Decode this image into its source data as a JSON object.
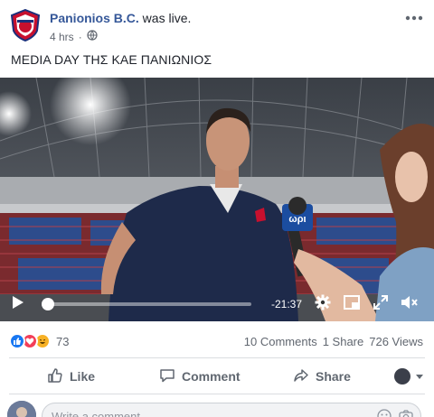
{
  "header": {
    "page_name": "Panionios B.C.",
    "action_text": " was live.",
    "time_ago": "4 hrs",
    "privacy_icon": "globe-icon",
    "more_icon": "more-dots-icon"
  },
  "post": {
    "caption": "MEDIA DAY ΤΗΣ ΚΑΕ ΠΑΝΙΩΝΙΟΣ"
  },
  "video": {
    "time_remaining": "-21:37",
    "progress_fraction": 0.02,
    "controls": [
      "play-icon",
      "gear-icon",
      "miniplayer-icon",
      "fullscreen-icon",
      "volume-icon"
    ]
  },
  "stats": {
    "reactions": [
      "like",
      "love",
      "haha"
    ],
    "reaction_count": "73",
    "comments": "10 Comments",
    "shares": "1 Share",
    "views": "726 Views"
  },
  "actions": {
    "like": "Like",
    "comment": "Comment",
    "share": "Share"
  },
  "comment_box": {
    "placeholder": "Write a comment..."
  },
  "colors": {
    "link": "#365899",
    "like_blue": "#1877f2",
    "love_red": "#f33e58",
    "haha_yellow": "#f7b125",
    "panionios_red": "#c8102e",
    "panionios_blue": "#1c2f7a"
  }
}
